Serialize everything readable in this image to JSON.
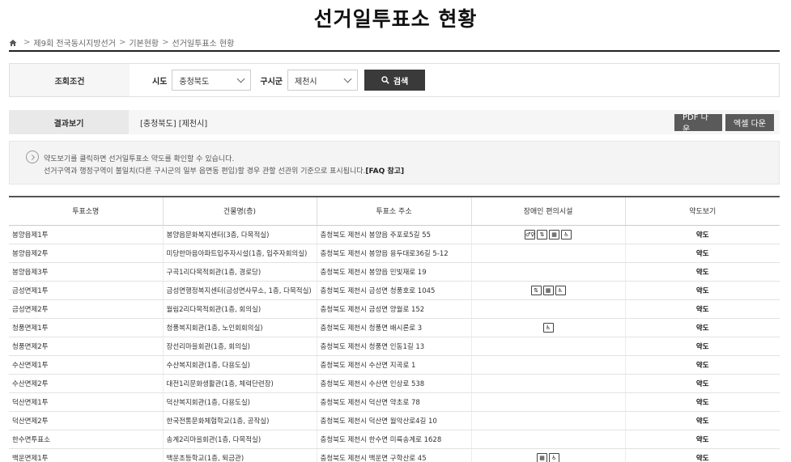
{
  "page": {
    "title": "선거일투표소 현황"
  },
  "breadcrumb": [
    "제9회 전국동시지방선거",
    "기본현황",
    "선거일투표소 현황"
  ],
  "search": {
    "section_label": "조회조건",
    "sido_label": "시도",
    "sido_value": "충청북도",
    "sigungu_label": "구시군",
    "sigungu_value": "제천시",
    "button_label": "검색"
  },
  "result": {
    "section_label": "결과보기",
    "filter_text": "[충청북도] [제천시]",
    "pdf_label": "PDF 다운",
    "excel_label": "엑셀 다운"
  },
  "notice": {
    "line1": "약도보기를 클릭하면 선거일투표소 약도를 확인할 수 있습니다.",
    "line2": "선거구역과 행정구역이 불일치(다른 구시군의 일부 읍면동 편입)할 경우 관할 선관위 기준으로 표시됩니다.",
    "line2_link": "[FAQ 참고]"
  },
  "table": {
    "headers": [
      "투표소명",
      "건물명(층)",
      "투표소 주소",
      "장애인 편의시설",
      "약도보기"
    ],
    "rows": [
      {
        "name": "봉양읍제1투",
        "building": "봉양읍문화복지센터(3층, 다목적실)",
        "address": "충청북도 제천시 봉양읍 주포로5길 55",
        "facilities": [
          "restroom-icon",
          "elevator-icon",
          "braille-block-icon",
          "wheelchair-icon"
        ],
        "map": "약도"
      },
      {
        "name": "봉양읍제2투",
        "building": "미당한마음아파트입주자시설(1층, 입주자회의실)",
        "address": "충청북도 제천시 봉양읍 용두대로36길 5-12",
        "facilities": [],
        "map": "약도"
      },
      {
        "name": "봉양읍제3투",
        "building": "구곡1리다목적회관(1층, 경로당)",
        "address": "충청북도 제천시 봉양읍 민빛재로 19",
        "facilities": [],
        "map": "약도"
      },
      {
        "name": "금성면제1투",
        "building": "금성면행정복지센터(금성면사무소, 1층, 다목적실)",
        "address": "충청북도 제천시 금성면 청풍호로 1045",
        "facilities": [
          "elevator-icon",
          "braille-block-icon",
          "wheelchair-icon"
        ],
        "map": "약도"
      },
      {
        "name": "금성면제2투",
        "building": "월림2리다목적회관(1층, 회의실)",
        "address": "충청북도 제천시 금성면 양월로 152",
        "facilities": [],
        "map": "약도"
      },
      {
        "name": "청풍면제1투",
        "building": "청풍복지회관(1층, 노인회회의실)",
        "address": "충청북도 제천시 청풍면 배시론로 3",
        "facilities": [
          "wheelchair-icon"
        ],
        "map": "약도"
      },
      {
        "name": "청풍면제2투",
        "building": "장선리마을회관(1층, 회의실)",
        "address": "충청북도 제천시 청풍면 인동1길 13",
        "facilities": [],
        "map": "약도"
      },
      {
        "name": "수산면제1투",
        "building": "수산복지회관(1층, 다용도실)",
        "address": "충청북도 제천시 수산면 지곡로 1",
        "facilities": [],
        "map": "약도"
      },
      {
        "name": "수산면제2투",
        "building": "대전1리문화생활관(1층, 체력단련장)",
        "address": "충청북도 제천시 수산면 인상로 538",
        "facilities": [],
        "map": "약도"
      },
      {
        "name": "덕산면제1투",
        "building": "덕산복지회관(1층, 다용도실)",
        "address": "충청북도 제천시 덕산면 약초로 78",
        "facilities": [],
        "map": "약도"
      },
      {
        "name": "덕산면제2투",
        "building": "한국전통문화체험학교(1층, 공작실)",
        "address": "충청북도 제천시 덕산면 월악산로4길 10",
        "facilities": [],
        "map": "약도"
      },
      {
        "name": "한수면투표소",
        "building": "송계2리마을회관(1층, 다목적실)",
        "address": "충청북도 제천시 한수면 미륵송계로 1628",
        "facilities": [],
        "map": "약도"
      },
      {
        "name": "백운면제1투",
        "building": "백운초등학교(1층, 퇴금관)",
        "address": "충청북도 제천시 백운면 구학산로 45",
        "facilities": [
          "braille-block-icon",
          "wheelchair-icon"
        ],
        "map": "약도"
      }
    ]
  }
}
